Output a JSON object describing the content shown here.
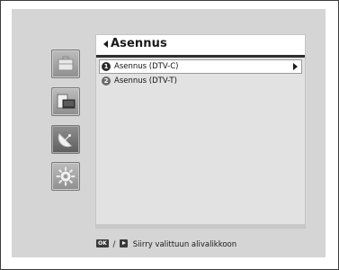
{
  "menu": {
    "title": "Asennus",
    "items": [
      {
        "number": "1",
        "label": "Asennus (DTV-C)",
        "selected": true
      },
      {
        "number": "2",
        "label": "Asennus (DTV-T)",
        "selected": false
      }
    ]
  },
  "sidebar": {
    "icons": [
      "briefcase-icon",
      "devices-icon",
      "satellite-dish-icon",
      "settings-gear-icon"
    ],
    "active": "satellite-dish-icon"
  },
  "hint": {
    "ok_key": "OK",
    "separator": "/",
    "text": "Siirry valittuun alivalikkoon"
  },
  "colors": {
    "screen_bg": "#d5d5d5",
    "panel_bg": "#e2e2e2",
    "title_bar_border": "#2f2f2f",
    "selected_row_bg": "#ffffff"
  }
}
